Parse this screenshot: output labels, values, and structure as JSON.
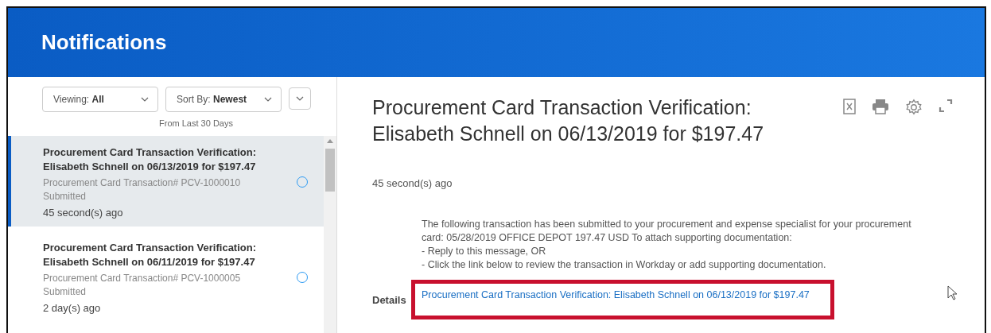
{
  "header": {
    "title": "Notifications"
  },
  "filters": [
    {
      "label": "Viewing:",
      "value": "All"
    },
    {
      "label": "Sort By:",
      "value": "Newest"
    }
  ],
  "range_note": "From Last 30 Days",
  "notifications": [
    {
      "title": "Procurement Card Transaction Verification: Elisabeth Schnell on 06/13/2019 for $197.47",
      "subtitle": "Procurement Card Transaction# PCV-1000010",
      "status": "Submitted",
      "time": "45 second(s) ago",
      "unread": true,
      "selected": true
    },
    {
      "title": "Procurement Card Transaction Verification: Elisabeth Schnell on 06/11/2019 for $197.47",
      "subtitle": "Procurement Card Transaction# PCV-1000005",
      "status": "Submitted",
      "time": "2 day(s) ago",
      "unread": true,
      "selected": false
    }
  ],
  "detail": {
    "title": "Procurement Card Transaction Verification: Elisabeth Schnell on 06/13/2019 for $197.47",
    "time": "45 second(s) ago",
    "message_lines": [
      "The following transaction has been submitted to your procurement and expense specialist for your procurement card: 05/28/2019 OFFICE DEPOT 197.47 USD To attach supporting documentation:",
      "- Reply to this message, OR",
      "- Click the link below to review the transaction in Workday or add supporting documentation."
    ],
    "details_label": "Details",
    "details_link": "Procurement Card Transaction Verification: Elisabeth Schnell on 06/13/2019 for $197.47",
    "highlighted": true
  }
}
